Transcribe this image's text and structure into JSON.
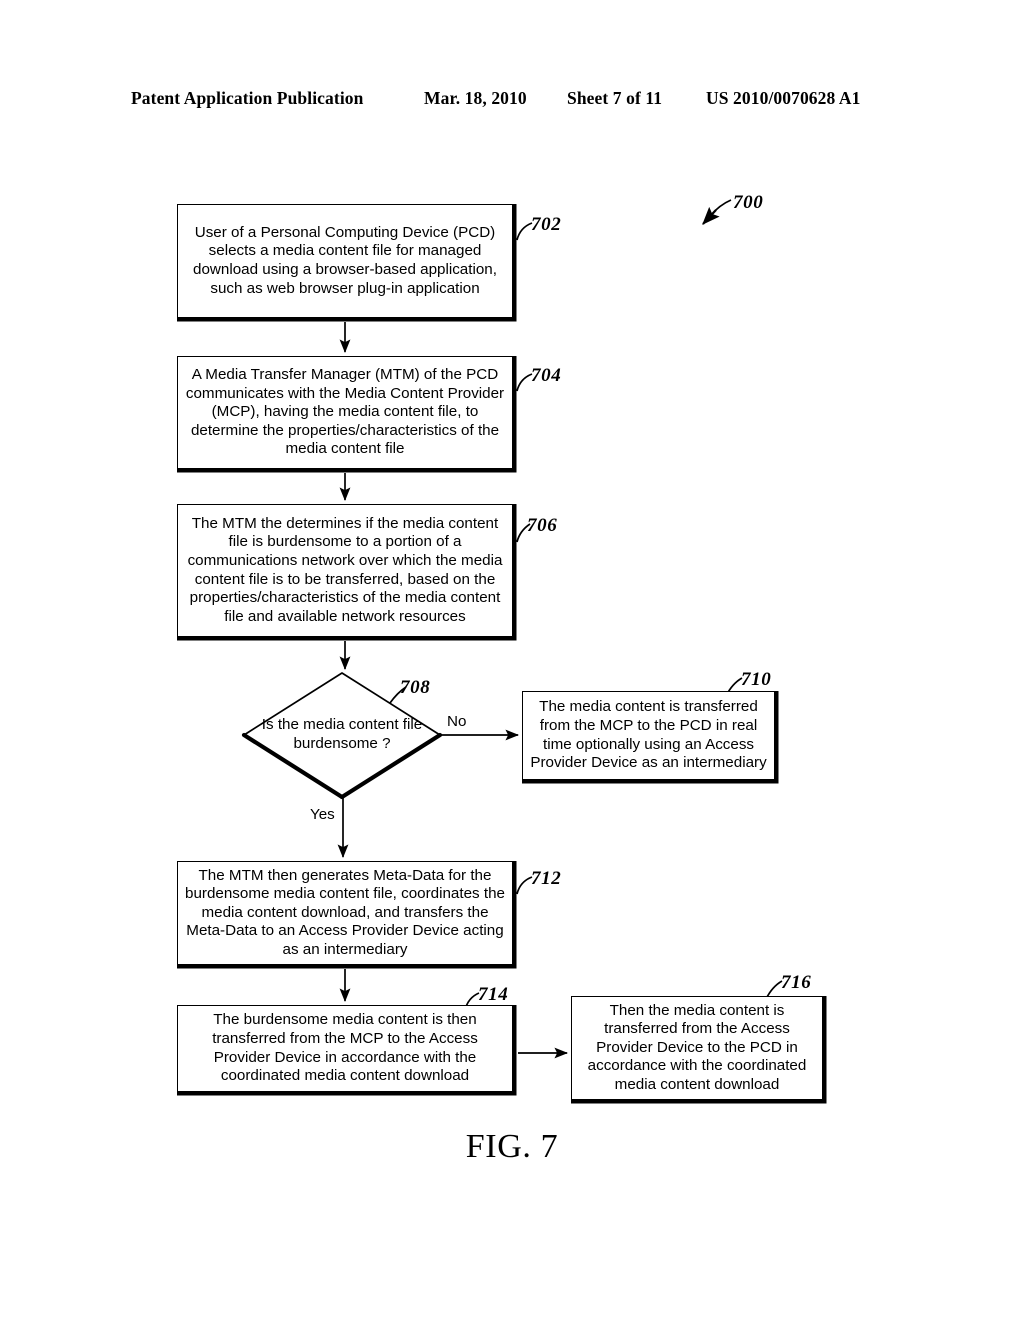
{
  "header": {
    "publication": "Patent Application Publication",
    "date": "Mar. 18, 2010",
    "sheet": "Sheet 7 of 11",
    "patent_number": "US 2010/0070628 A1"
  },
  "figure": {
    "caption": "FIG. 7",
    "diagram_ref": "700"
  },
  "nodes": {
    "n702": {
      "ref": "702",
      "text": "User of a Personal Computing Device (PCD) selects a media content file for managed download using a browser-based application, such as web browser plug-in application"
    },
    "n704": {
      "ref": "704",
      "text": "A Media Transfer Manager (MTM) of the PCD communicates with the Media Content Provider (MCP), having the media content file, to determine the properties/characteristics of the media content file"
    },
    "n706": {
      "ref": "706",
      "text": "The MTM the determines if the media content file is burdensome to a portion of a communications network over which the media content file is to be transferred, based on the properties/characteristics of the media content file and available network resources"
    },
    "n708": {
      "ref": "708",
      "text": "Is the media content file burdensome ?"
    },
    "n710": {
      "ref": "710",
      "text": "The media content is transferred from the MCP to the PCD in real time optionally using an Access Provider Device as an intermediary"
    },
    "n712": {
      "ref": "712",
      "text": "The MTM then generates Meta-Data for the burdensome media content file, coordinates the media content download, and transfers the Meta-Data to an Access Provider Device acting as an intermediary"
    },
    "n714": {
      "ref": "714",
      "text": "The burdensome media content is then transferred from the MCP to the Access Provider Device in accordance with the coordinated media content download"
    },
    "n716": {
      "ref": "716",
      "text": "Then the media content is transferred from the Access Provider Device to the PCD in accordance with the coordinated media content download"
    }
  },
  "edges": {
    "no_label": "No",
    "yes_label": "Yes"
  },
  "colors": {
    "ink": "#000000",
    "paper": "#ffffff"
  }
}
